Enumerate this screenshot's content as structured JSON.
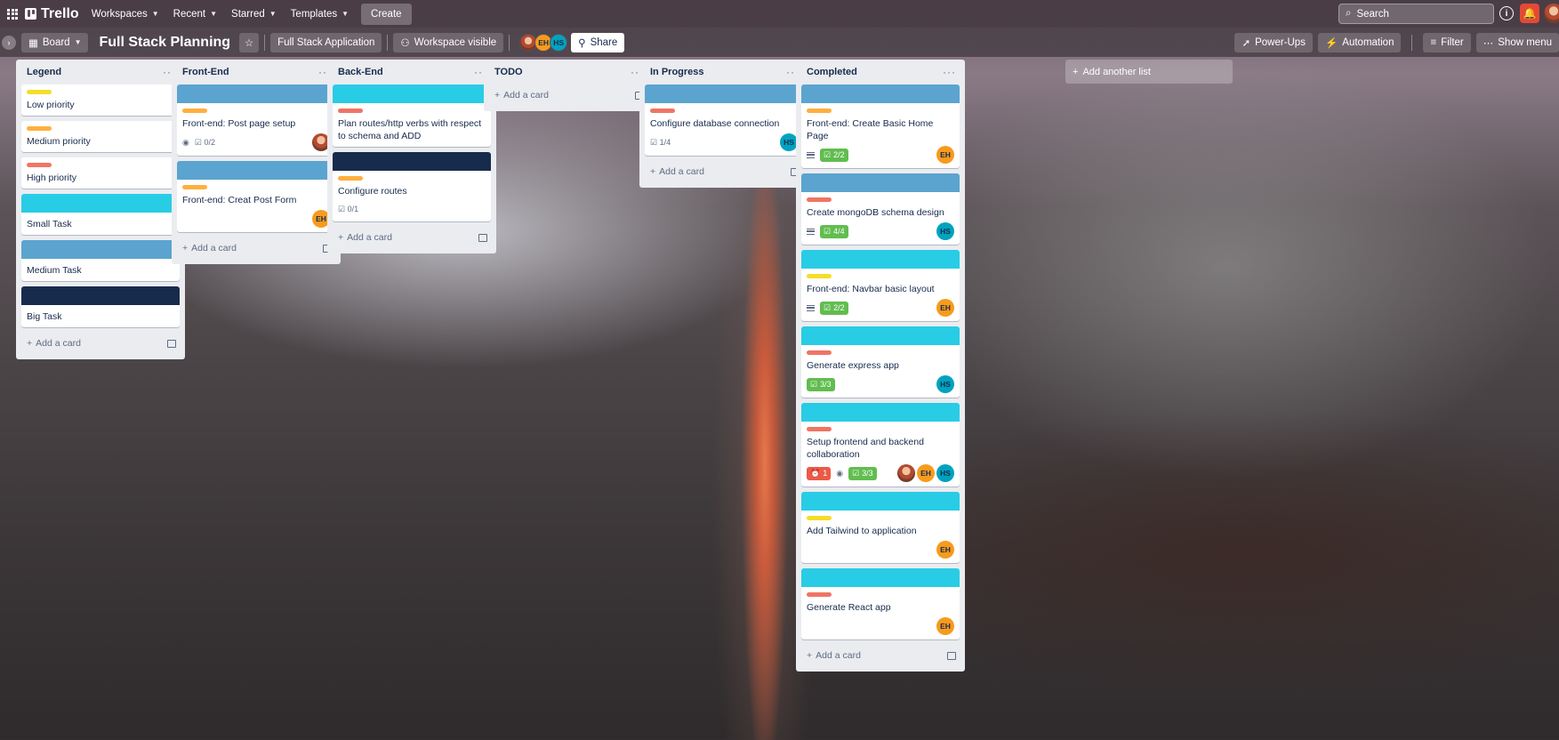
{
  "topbar": {
    "app_name": "Trello",
    "nav": [
      {
        "label": "Workspaces"
      },
      {
        "label": "Recent"
      },
      {
        "label": "Starred"
      },
      {
        "label": "Templates"
      }
    ],
    "create_label": "Create",
    "search_placeholder": "Search",
    "notification_count": ""
  },
  "boardbar": {
    "view_label": "Board",
    "title": "Full Stack Planning",
    "workspace_label": "Full Stack Application",
    "visibility_label": "Workspace visible",
    "members": [
      "EH",
      "HS"
    ],
    "share_label": "Share",
    "powerups_label": "Power-Ups",
    "automation_label": "Automation",
    "filter_label": "Filter",
    "menu_label": "Show menu"
  },
  "lists": [
    {
      "title": "Legend",
      "cards": [
        {
          "label": "yellow",
          "text": "Low priority"
        },
        {
          "label": "orange",
          "text": "Medium priority"
        },
        {
          "label": "red",
          "text": "High priority"
        },
        {
          "cover": "small",
          "text": "Small Task"
        },
        {
          "cover": "medium",
          "text": "Medium Task"
        },
        {
          "cover": "big",
          "text": "Big Task"
        }
      ],
      "add_label": "Add a card"
    },
    {
      "title": "Front-End",
      "cards": [
        {
          "cover": "medium",
          "label": "orange",
          "text": "Front-end: Post page setup",
          "watch": true,
          "checklist": "0/2",
          "avatars": [
            "photo"
          ]
        },
        {
          "cover": "medium",
          "label": "orange",
          "text": "Front-end: Creat Post Form",
          "avatars": [
            "EH"
          ]
        }
      ],
      "add_label": "Add a card"
    },
    {
      "title": "Back-End",
      "cards": [
        {
          "cover": "small",
          "label": "red",
          "text": "Plan routes/http verbs with respect to schema and ADD"
        },
        {
          "cover": "big",
          "label": "orange",
          "text": "Configure routes",
          "checklist": "0/1"
        }
      ],
      "add_label": "Add a card"
    },
    {
      "title": "TODO",
      "cards": [],
      "add_label": "Add a card"
    },
    {
      "title": "In Progress",
      "cards": [
        {
          "cover": "medium",
          "label": "red",
          "text": "Configure database connection",
          "checklist": "1/4",
          "avatars": [
            "HS"
          ]
        }
      ],
      "add_label": "Add a card"
    },
    {
      "title": "Completed",
      "cards": [
        {
          "cover": "medium",
          "label": "orange",
          "text": "Front-end: Create Basic Home Page",
          "desc": true,
          "checklist_done": "2/2",
          "avatars": [
            "EH"
          ]
        },
        {
          "cover": "medium",
          "label": "red",
          "text": "Create mongoDB schema design",
          "desc": true,
          "checklist_done": "4/4",
          "avatars": [
            "HS"
          ]
        },
        {
          "cover": "small",
          "label": "yellow",
          "text": "Front-end: Navbar basic layout",
          "desc": true,
          "checklist_done": "2/2",
          "avatars": [
            "EH"
          ]
        },
        {
          "cover": "small",
          "label": "red",
          "text": "Generate express app",
          "checklist_done": "3/3",
          "avatars": [
            "HS"
          ]
        },
        {
          "cover": "small",
          "label": "red",
          "text": "Setup frontend and backend collaboration",
          "alert": "1",
          "watch": true,
          "checklist_done": "3/3",
          "avatars": [
            "photo",
            "EH",
            "HS"
          ]
        },
        {
          "cover": "small",
          "label": "yellow",
          "text": "Add Tailwind to application",
          "avatars": [
            "EH"
          ]
        },
        {
          "cover": "small",
          "label": "red",
          "text": "Generate React app",
          "avatars": [
            "EH"
          ]
        }
      ],
      "add_label": "Add a card"
    }
  ],
  "add_list_label": "Add another list",
  "colors": {
    "label_yellow": "#f5dd29",
    "label_orange": "#ffaf3f",
    "label_red": "#ef7564",
    "cover_small": "#29cce5",
    "cover_medium": "#5ba4cf",
    "cover_big": "#172b4d",
    "checklist_done": "#61bd4f",
    "avatar_eh": "#f79b1c",
    "avatar_hs": "#00a3bf"
  }
}
